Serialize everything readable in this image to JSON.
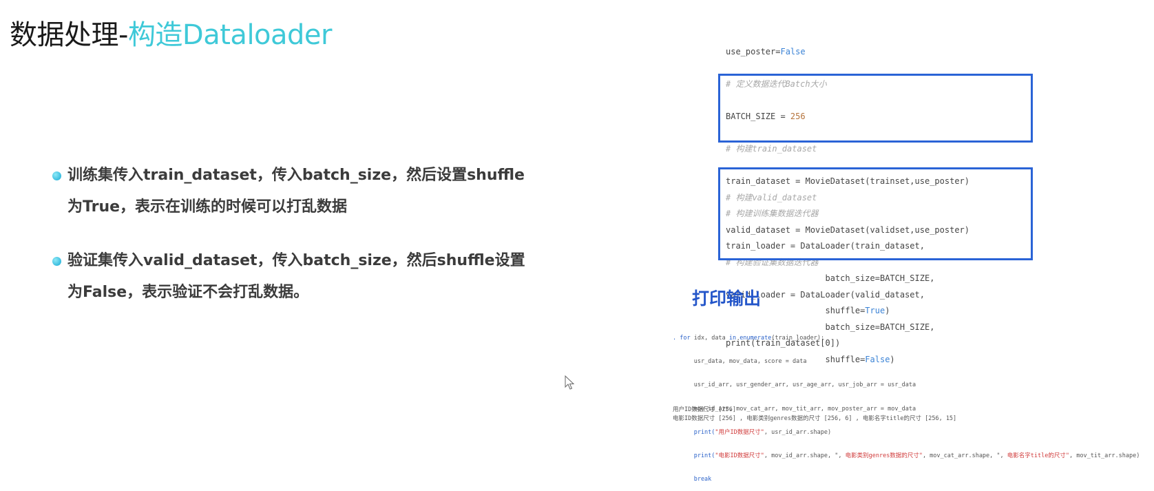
{
  "title": {
    "main": "数据处理-",
    "accent": "构造Dataloader"
  },
  "bullets": [
    {
      "line1": "训练集传入train_dataset，传入batch_size，然后设置shuffle",
      "line2": "为True，表示在训练的时候可以打乱数据"
    },
    {
      "line1": "验证集传入valid_dataset，传入batch_size，然后shuffle设置",
      "line2": "为False，表示验证不会打乱数据。"
    }
  ],
  "code_top": {
    "l1_a": "use_poster=",
    "l1_b": "False",
    "l2": "# 定义数据迭代Batch大小",
    "l3_a": "BATCH_SIZE = ",
    "l3_b": "256",
    "l4": "# 构建train_dataset",
    "l5": "train_dataset = MovieDataset(trainset,use_poster)",
    "l6": "# 构建训练集数据迭代器",
    "l7": "train_loader = DataLoader(train_dataset,",
    "l8": "                    batch_size=BATCH_SIZE,",
    "l9_a": "                    shuffle=",
    "l9_b": "True",
    "l9_c": ")",
    "l10": "print(train_dataset[0])"
  },
  "code_valid": {
    "l1": "# 构建valid_dataset",
    "l2": "valid_dataset = MovieDataset(validset,use_poster)",
    "l3": "# 构建验证集数据迭代器",
    "l4": "valid_loader = DataLoader(valid_dataset,",
    "l5": "                    batch_size=BATCH_SIZE,",
    "l6_a": "                    shuffle=",
    "l6_b": "False",
    "l6_c": ")"
  },
  "print_title": "打印输出",
  "print_code": {
    "l1_a": ". for",
    "l1_b": " idx, data ",
    "l1_c": "in",
    "l1_d": " ",
    "l1_e": "enumerate",
    "l1_f": "(train_loader):",
    "l2": "      usr_data, mov_data, score = data",
    "l3": "      usr_id_arr, usr_gender_arr, usr_age_arr, usr_job_arr = usr_data",
    "l4": "      mov_id_arr, mov_cat_arr, mov_tit_arr, mov_poster_arr = mov_data",
    "l5_a": "      print(",
    "l5_b": "\"用户ID数据尺寸\"",
    "l5_c": ", usr_id_arr.shape)",
    "l6_a": "      print(",
    "l6_b": "\"电影ID数据尺寸\"",
    "l6_c": ", mov_id_arr.shape, \", ",
    "l6_d": "电影类别genres数据的尺寸\"",
    "l6_e": ", mov_cat_arr.shape, \", ",
    "l6_f": "电影名字title的尺寸\"",
    "l6_g": ", mov_tit_arr.shape)",
    "l7": "      break"
  },
  "output": {
    "l1": "用户ID数据尺寸 [256]",
    "l2": "电影ID数据尺寸 [256] , 电影类别genres数据的尺寸 [256, 6] , 电影名字title的尺寸 [256, 15]"
  }
}
